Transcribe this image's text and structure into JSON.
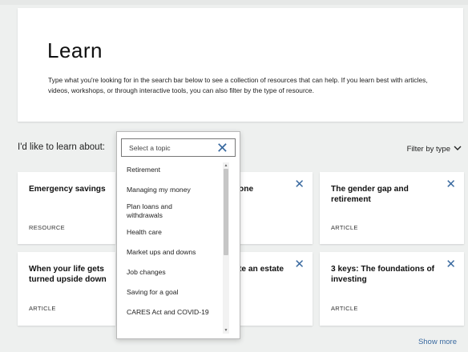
{
  "hero": {
    "title": "Learn",
    "description": "Type what you're looking for in the search bar below to see a collection of resources that can help. If you learn best with articles, videos, workshops, or through interactive tools, you can also filter by the type of resource."
  },
  "filter": {
    "learn_label": "I'd like to learn about:",
    "filter_by_type": "Filter by type"
  },
  "dropdown": {
    "placeholder": "Select a topic",
    "options": [
      "Retirement",
      "Managing my money",
      "Plan loans and withdrawals",
      "Health care",
      "Market ups and downs",
      "Job changes",
      "Saving for a goal",
      "CARES Act and COVID-19"
    ]
  },
  "cards": [
    {
      "title": "Emergency savings",
      "type": "RESOURCE"
    },
    {
      "title_fragment": "one"
    },
    {
      "title": "The gender gap and retirement",
      "type": "ARTICLE"
    },
    {
      "title": "When your life gets turned upside down",
      "type": "ARTICLE"
    },
    {
      "title_fragment": "te an estate"
    },
    {
      "title": "3 keys: The foundations of investing",
      "type": "ARTICLE"
    }
  ],
  "show_more": "Show more"
}
